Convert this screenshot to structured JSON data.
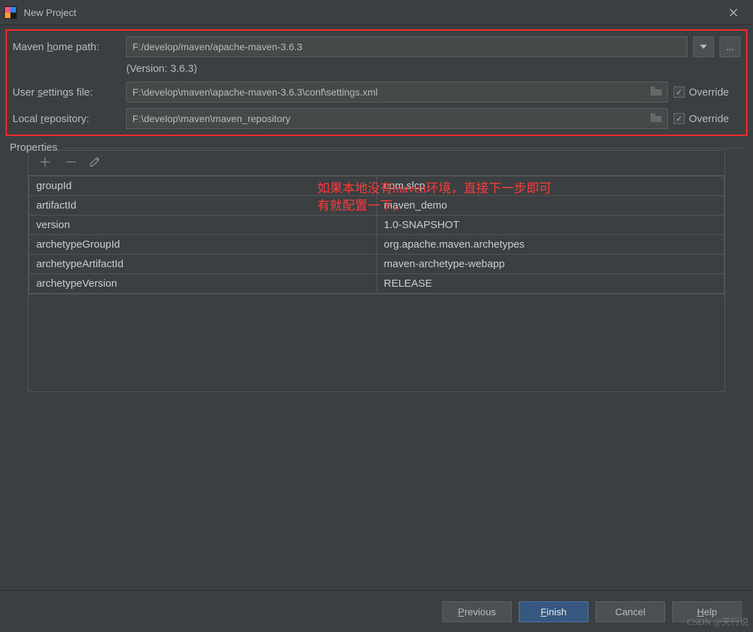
{
  "window": {
    "title": "New Project"
  },
  "form": {
    "mavenHome": {
      "label_pre": "Maven ",
      "label_u": "h",
      "label_post": "ome path:",
      "value": "F:/develop/maven/apache-maven-3.6.3",
      "browse": "...",
      "version": "(Version: 3.6.3)"
    },
    "settings": {
      "label_pre": "User ",
      "label_u": "s",
      "label_post": "ettings file:",
      "value": "F:\\develop\\maven\\apache-maven-3.6.3\\conf\\settings.xml",
      "override": "Override"
    },
    "repo": {
      "label_pre": "Local ",
      "label_u": "r",
      "label_post": "epository:",
      "value": "F:\\develop\\maven\\maven_repository",
      "override": "Override"
    }
  },
  "propsLabel": "Properties",
  "props": [
    {
      "k": "groupId",
      "v": "com.slcp"
    },
    {
      "k": "artifactId",
      "v": "maven_demo"
    },
    {
      "k": "version",
      "v": "1.0-SNAPSHOT"
    },
    {
      "k": "archetypeGroupId",
      "v": "org.apache.maven.archetypes"
    },
    {
      "k": "archetypeArtifactId",
      "v": "maven-archetype-webapp"
    },
    {
      "k": "archetypeVersion",
      "v": "RELEASE"
    }
  ],
  "annot": "如果本地没有maven环境，直接下一步即可\n有就配置一下。",
  "footer": {
    "prev_u": "P",
    "prev": "revious",
    "finish_u": "F",
    "finish": "inish",
    "cancel": "Cancel",
    "help_u": "H",
    "help": "elp"
  },
  "watermark": "CSDN @天行说",
  "check": "✓"
}
